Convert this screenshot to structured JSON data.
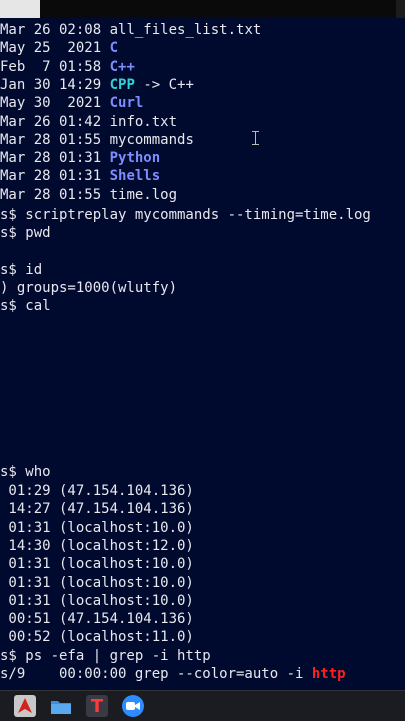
{
  "terminal": {
    "listing": [
      {
        "date": "Mar 26 02:08",
        "name": "all_files_list.txt",
        "kind": "file"
      },
      {
        "date": "May 25  2021",
        "name": "C",
        "kind": "dir"
      },
      {
        "date": "Feb  7 01:58",
        "name": "C++",
        "kind": "dir"
      },
      {
        "date": "Jan 30 14:29",
        "name": "CPP",
        "kind": "link",
        "target": " -> C++"
      },
      {
        "date": "May 30  2021",
        "name": "Curl",
        "kind": "dir"
      },
      {
        "date": "Mar 26 01:42",
        "name": "info.txt",
        "kind": "file"
      },
      {
        "date": "Mar 28 01:55",
        "name": "mycommands",
        "kind": "file"
      },
      {
        "date": "Mar 28 01:31",
        "name": "Python",
        "kind": "dir"
      },
      {
        "date": "Mar 28 01:31",
        "name": "Shells",
        "kind": "dir"
      },
      {
        "date": "Mar 28 01:55",
        "name": "time.log",
        "kind": "file"
      }
    ],
    "cmd_scriptreplay": "s$ scriptreplay mycommands --timing=time.log",
    "cmd_pwd": "s$ pwd",
    "cmd_id": "s$ id",
    "id_output": ") groups=1000(wlutfy)",
    "cmd_cal": "s$ cal",
    "cmd_who": "s$ who",
    "who_rows": [
      " 01:29 (47.154.104.136)",
      " 14:27 (47.154.104.136)",
      " 01:31 (localhost:10.0)",
      " 14:30 (localhost:12.0)",
      " 01:31 (localhost:10.0)",
      " 01:31 (localhost:10.0)",
      " 01:31 (localhost:10.0)",
      " 00:51 (47.154.104.136)",
      " 00:52 (localhost:11.0)"
    ],
    "cmd_ps": "s$ ps -efa | grep -i http",
    "ps_prefix": "s/9    00:00:00 grep --color=auto -i ",
    "ps_match": "http"
  },
  "colors": {
    "background": "#000a2e",
    "text": "#e8e8ee",
    "directory": "#7e8cff",
    "symlink": "#2fd3d3",
    "grep_match": "#ff2020"
  },
  "taskbar": {
    "icons": [
      "red-app-icon",
      "folder-icon",
      "text-editor-icon",
      "video-meeting-icon"
    ],
    "editor_glyph": "T"
  }
}
